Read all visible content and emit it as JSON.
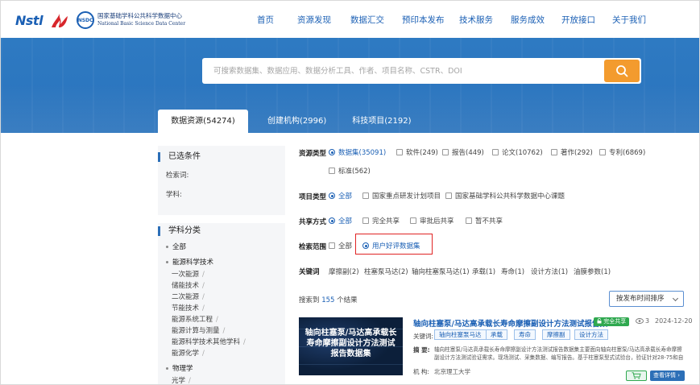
{
  "header": {
    "logo_nstl": "Nstl",
    "logo_nsdc_mark": "NSDC",
    "logo_nsdc_cn": "国家基础学科公共科学数据中心",
    "logo_nsdc_en": "National Basic Science Data Center",
    "nav": [
      "首页",
      "资源发现",
      "数据汇交",
      "预印本发布",
      "技术服务",
      "服务成效",
      "开放接口",
      "关于我们"
    ]
  },
  "search": {
    "placeholder": "可搜索数据集、数据应用、数据分析工具、作者、项目名称、CSTR、DOI"
  },
  "tabs": [
    "数据资源(54274)",
    "创建机构(2996)",
    "科技项目(2192)"
  ],
  "sidebar": {
    "selected_title": "已选条件",
    "keyword_label": "检索词:",
    "subject_label": "学科:",
    "subject_title": "学科分类",
    "all": "全部",
    "groups": [
      {
        "name": "能源科学技术",
        "children": [
          "一次能源",
          "储能技术",
          "二次能源",
          "节能技术",
          "能源系统工程",
          "能源计算与测量",
          "能源科学技术其他学科",
          "能源化学"
        ]
      },
      {
        "name": "物理学",
        "children": [
          "光学"
        ]
      }
    ]
  },
  "filters": {
    "resource_type": {
      "label": "资源类型",
      "options": [
        "数据集(35091)",
        "软件(249)",
        "报告(449)",
        "论文(10762)",
        "著作(292)",
        "专利(6869)",
        "标准(562)"
      ],
      "selected": 0
    },
    "project_type": {
      "label": "项目类型",
      "options": [
        "全部",
        "国家重点研发计划项目",
        "国家基础学科公共科学数据中心课题"
      ],
      "selected": 0
    },
    "share_mode": {
      "label": "共享方式",
      "options": [
        "全部",
        "完全共享",
        "审批后共享",
        "暂不共享"
      ],
      "selected": 0
    },
    "search_scope": {
      "label": "检索范围",
      "options": [
        "全部",
        "用户好评数据集"
      ],
      "selected": 1
    },
    "keywords": {
      "label": "关键词",
      "items": [
        "摩擦副(2)",
        "柱塞泵马达(2)",
        "轴向柱塞泵马达(1)",
        "承载(1)",
        "寿命(1)",
        "设计方法(1)",
        "油膜参数(1)"
      ]
    }
  },
  "results": {
    "count_prefix": "搜索到",
    "count": "155",
    "count_suffix": "个结果",
    "sort": "按发布时间排序",
    "items": [
      {
        "thumb_text": "轴向柱塞泵/马达高承载长寿命摩擦副设计方法测试报告数据集",
        "title": "轴向柱塞泵/马达高承载长寿命摩擦副设计方法测试报告数...",
        "badge": "完全共享",
        "views": "3",
        "date": "2024-12-20",
        "kw_label": "关键词:",
        "tags": [
          "轴向柱塞泵马达",
          "承载",
          "寿命",
          "摩擦副",
          "设计方法"
        ],
        "abstract_label": "摘 要:",
        "abstract": "轴向柱塞泵/马达高承载长寿命摩擦副设计方法测试报告数据集主要面向轴向柱塞泵/马达高承载长寿命摩擦副设计方法测试验证需求。现场测试、采集数据、编写报告。基于柱塞泵型式试验台，验证针对28-75和自主设计试验",
        "org_label": "机 构:",
        "org": "北京理工大学",
        "detail": "查看详情"
      }
    ]
  },
  "colors": {
    "brand_blue": "#1a5fb4",
    "hero_blue": "#2c76bf",
    "search_orange": "#f39b2e",
    "share_green": "#2fa84f",
    "highlight_red": "#e02424"
  }
}
